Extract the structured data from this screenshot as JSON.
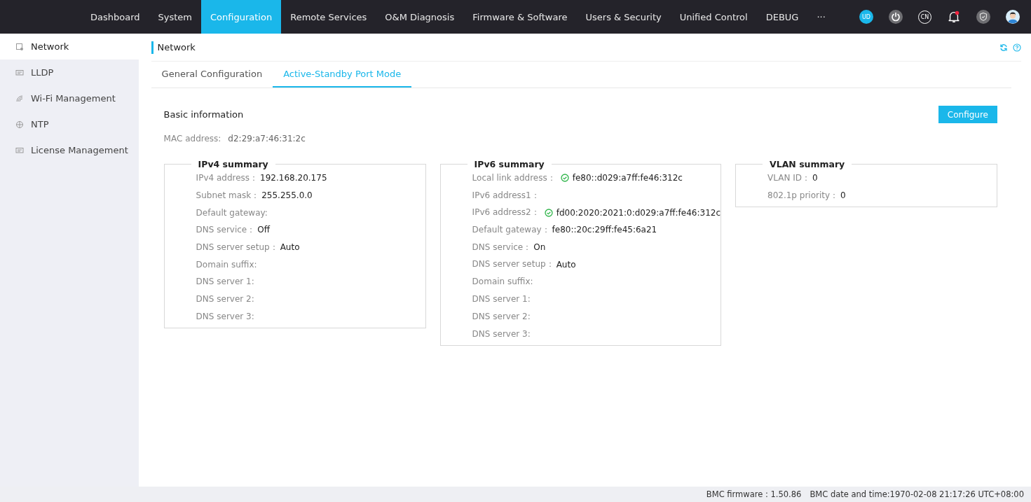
{
  "top_nav": [
    {
      "label": "Dashboard",
      "selected": false
    },
    {
      "label": "System",
      "selected": false
    },
    {
      "label": "Configuration",
      "selected": true
    },
    {
      "label": "Remote Services",
      "selected": false
    },
    {
      "label": "O&M Diagnosis",
      "selected": false
    },
    {
      "label": "Firmware & Software",
      "selected": false
    },
    {
      "label": "Users & Security",
      "selected": false
    },
    {
      "label": "Unified Control",
      "selected": false
    },
    {
      "label": "DEBUG",
      "selected": false
    },
    {
      "label": "···",
      "selected": false
    }
  ],
  "header_tools": {
    "badge": "UD",
    "language": "CN",
    "alert": true
  },
  "sidebar": {
    "items": [
      {
        "label": "Network",
        "selected": true
      },
      {
        "label": "LLDP",
        "selected": false
      },
      {
        "label": "Wi-Fi Management",
        "selected": false
      },
      {
        "label": "NTP",
        "selected": false
      },
      {
        "label": "License Management",
        "selected": false
      }
    ]
  },
  "page_title": "Network",
  "tabs": [
    {
      "label": "General Configuration",
      "selected": false
    },
    {
      "label": "Active-Standby Port Mode",
      "selected": true
    }
  ],
  "basic_info": {
    "title": "Basic information",
    "configure_button": "Configure",
    "mac_label": "MAC address:",
    "mac_value": "d2:29:a7:46:31:2c"
  },
  "summaries": [
    {
      "title": "IPv4 summary",
      "rows": [
        {
          "label": "IPv4 address：",
          "value": "192.168.20.175",
          "verified": false
        },
        {
          "label": "Subnet mask：",
          "value": "255.255.0.0",
          "verified": false
        },
        {
          "label": "Default gateway:",
          "value": "",
          "verified": false
        },
        {
          "label": "DNS service：",
          "value": "Off",
          "verified": false
        },
        {
          "label": "DNS server setup：",
          "value": "Auto",
          "verified": false
        },
        {
          "label": "Domain suffix:",
          "value": "",
          "verified": false
        },
        {
          "label": "DNS server 1:",
          "value": "",
          "verified": false
        },
        {
          "label": "DNS server 2:",
          "value": "",
          "verified": false
        },
        {
          "label": "DNS server 3:",
          "value": "",
          "verified": false
        }
      ]
    },
    {
      "title": "IPv6 summary",
      "rows": [
        {
          "label": "Local link address：",
          "value": "fe80::d029:a7ff:fe46:312c",
          "verified": true
        },
        {
          "label": "IPv6 address1：",
          "value": "",
          "verified": false
        },
        {
          "label": "IPv6 address2：",
          "value": "fd00:2020:2021:0:d029:a7ff:fe46:312c",
          "verified": true
        },
        {
          "label": "Default gateway：",
          "value": "fe80::20c:29ff:fe45:6a21",
          "verified": false
        },
        {
          "label": "DNS service：",
          "value": "On",
          "verified": false
        },
        {
          "label": "DNS server setup：",
          "value": "Auto",
          "verified": false
        },
        {
          "label": "Domain suffix:",
          "value": "",
          "verified": false
        },
        {
          "label": "DNS server 1:",
          "value": "",
          "verified": false
        },
        {
          "label": "DNS server 2:",
          "value": "",
          "verified": false
        },
        {
          "label": "DNS server 3:",
          "value": "",
          "verified": false
        }
      ]
    },
    {
      "title": "VLAN summary",
      "rows": [
        {
          "label": "VLAN ID：",
          "value": "0",
          "verified": false
        },
        {
          "label": "802.1p priority：",
          "value": "0",
          "verified": false
        }
      ]
    }
  ],
  "status_bar": {
    "firmware": "BMC firmware : 1.50.86",
    "datetime": "BMC date and time:1970-02-08 21:17:26 UTC+08:00"
  }
}
